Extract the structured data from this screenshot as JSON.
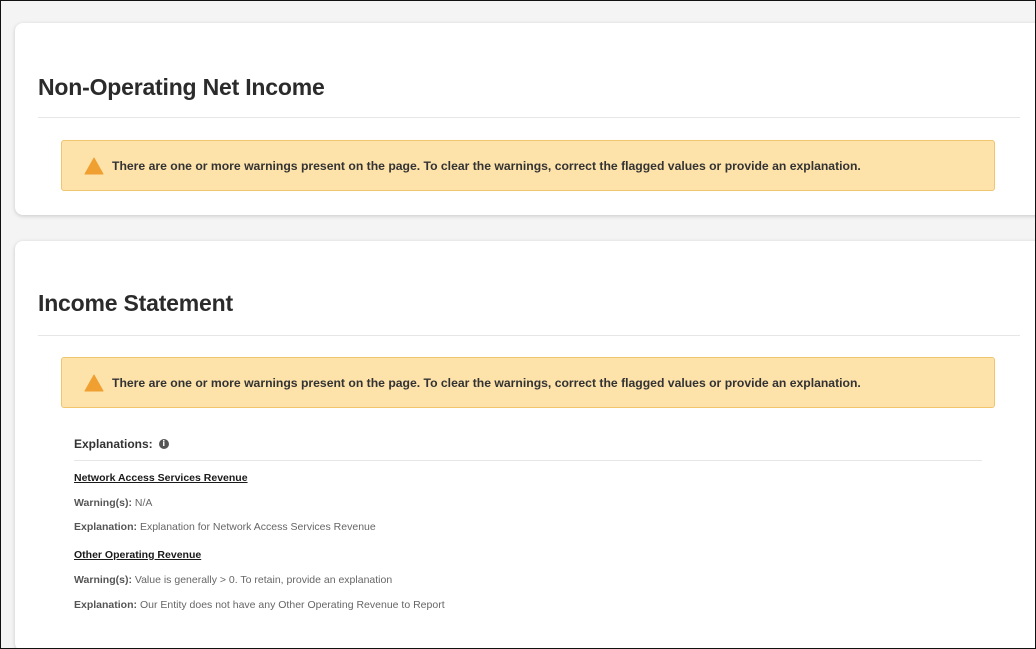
{
  "sections": [
    {
      "title": "Non-Operating Net Income",
      "warning": "There are one or more warnings present on the page. To clear the warnings, correct the flagged values or provide an explanation."
    },
    {
      "title": "Income Statement",
      "warning": "There are one or more warnings present on the page. To clear the warnings, correct the flagged values or provide an explanation.",
      "explanations_label": "Explanations:",
      "items": [
        {
          "name": "Network Access Services Revenue",
          "warning_label": "Warning(s):",
          "warning_value": "N/A",
          "explanation_label": "Explanation:",
          "explanation_value": "Explanation for Network Access Services Revenue"
        },
        {
          "name": "Other Operating Revenue",
          "warning_label": "Warning(s):",
          "warning_value": "Value is generally > 0. To retain, provide an explanation",
          "explanation_label": "Explanation:",
          "explanation_value": "Our Entity does not have any Other Operating Revenue to Report"
        }
      ]
    }
  ],
  "icons": {
    "alert": "warning-triangle-icon",
    "info": "info-circle-icon"
  },
  "colors": {
    "alert_bg": "#fde2aa",
    "alert_border": "#f1c46e",
    "warning_icon": "#f0a030"
  }
}
